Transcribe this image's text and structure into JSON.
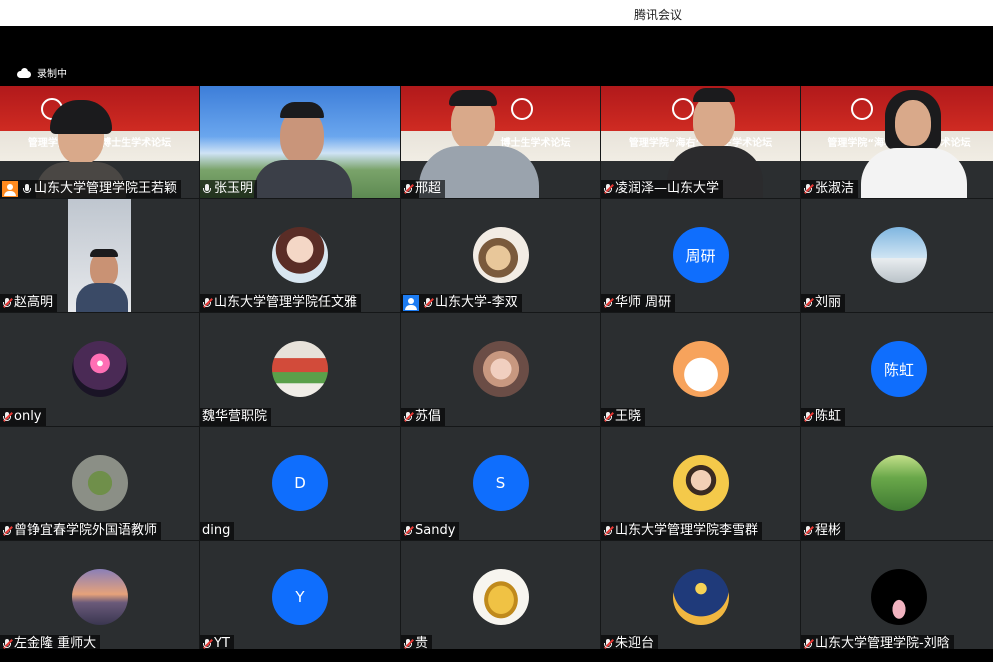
{
  "window": {
    "title": "腾讯会议"
  },
  "recording": {
    "label": "录制中"
  },
  "participants": [
    {
      "name": "山东大学管理学院王若颖",
      "host": true,
      "mic": "on",
      "kind": "video",
      "banner": "管理学院“海右”博士生学术论坛"
    },
    {
      "name": "张玉明",
      "mic": "on",
      "kind": "video"
    },
    {
      "name": "邢超",
      "mic": "muted",
      "kind": "video",
      "banner": "博士生学术论坛"
    },
    {
      "name": "凌润泽—山东大学",
      "mic": "muted",
      "kind": "video",
      "banner": "管理学院“海右”博士生学术论坛"
    },
    {
      "name": "张淑洁",
      "mic": "muted",
      "kind": "video",
      "banner": "管理学院“海右”博士生学术论坛"
    },
    {
      "name": "赵高明",
      "mic": "muted",
      "kind": "video"
    },
    {
      "name": "山东大学管理学院任文雅",
      "mic": "muted",
      "kind": "avatar"
    },
    {
      "name": "山东大学-李双",
      "mic": "muted",
      "kind": "avatar",
      "badge": true
    },
    {
      "name": "华师  周研",
      "mic": "muted",
      "kind": "letter",
      "avatar_text": "周研"
    },
    {
      "name": "刘丽",
      "mic": "muted",
      "kind": "avatar"
    },
    {
      "name": "only",
      "mic": "muted",
      "kind": "avatar"
    },
    {
      "name": "魏华营职院",
      "mic": "none",
      "kind": "avatar"
    },
    {
      "name": "苏倡",
      "mic": "muted",
      "kind": "avatar"
    },
    {
      "name": "王晓",
      "mic": "muted",
      "kind": "avatar"
    },
    {
      "name": "陈虹",
      "mic": "muted",
      "kind": "letter",
      "avatar_text": "陈虹"
    },
    {
      "name": "曾铮宜春学院外国语教师",
      "mic": "muted",
      "kind": "avatar"
    },
    {
      "name": "ding",
      "mic": "none",
      "kind": "letter",
      "avatar_text": "D"
    },
    {
      "name": "Sandy",
      "mic": "muted",
      "kind": "letter",
      "avatar_text": "S"
    },
    {
      "name": "山东大学管理学院李雪群",
      "mic": "muted",
      "kind": "avatar"
    },
    {
      "name": "程彬",
      "mic": "muted",
      "kind": "avatar"
    },
    {
      "name": "左金隆  重师大",
      "mic": "muted",
      "kind": "avatar"
    },
    {
      "name": "YT",
      "mic": "muted",
      "kind": "letter",
      "avatar_text": "Y"
    },
    {
      "name": "贵",
      "mic": "muted",
      "kind": "avatar"
    },
    {
      "name": "朱迎台",
      "mic": "muted",
      "kind": "avatar"
    },
    {
      "name": "山东大学管理学院-刘晗",
      "mic": "muted",
      "kind": "avatar"
    }
  ],
  "colors": {
    "accent": "#0f6efd",
    "tile_bg": "#2b2e30",
    "host_badge": "#ff8a1f"
  }
}
